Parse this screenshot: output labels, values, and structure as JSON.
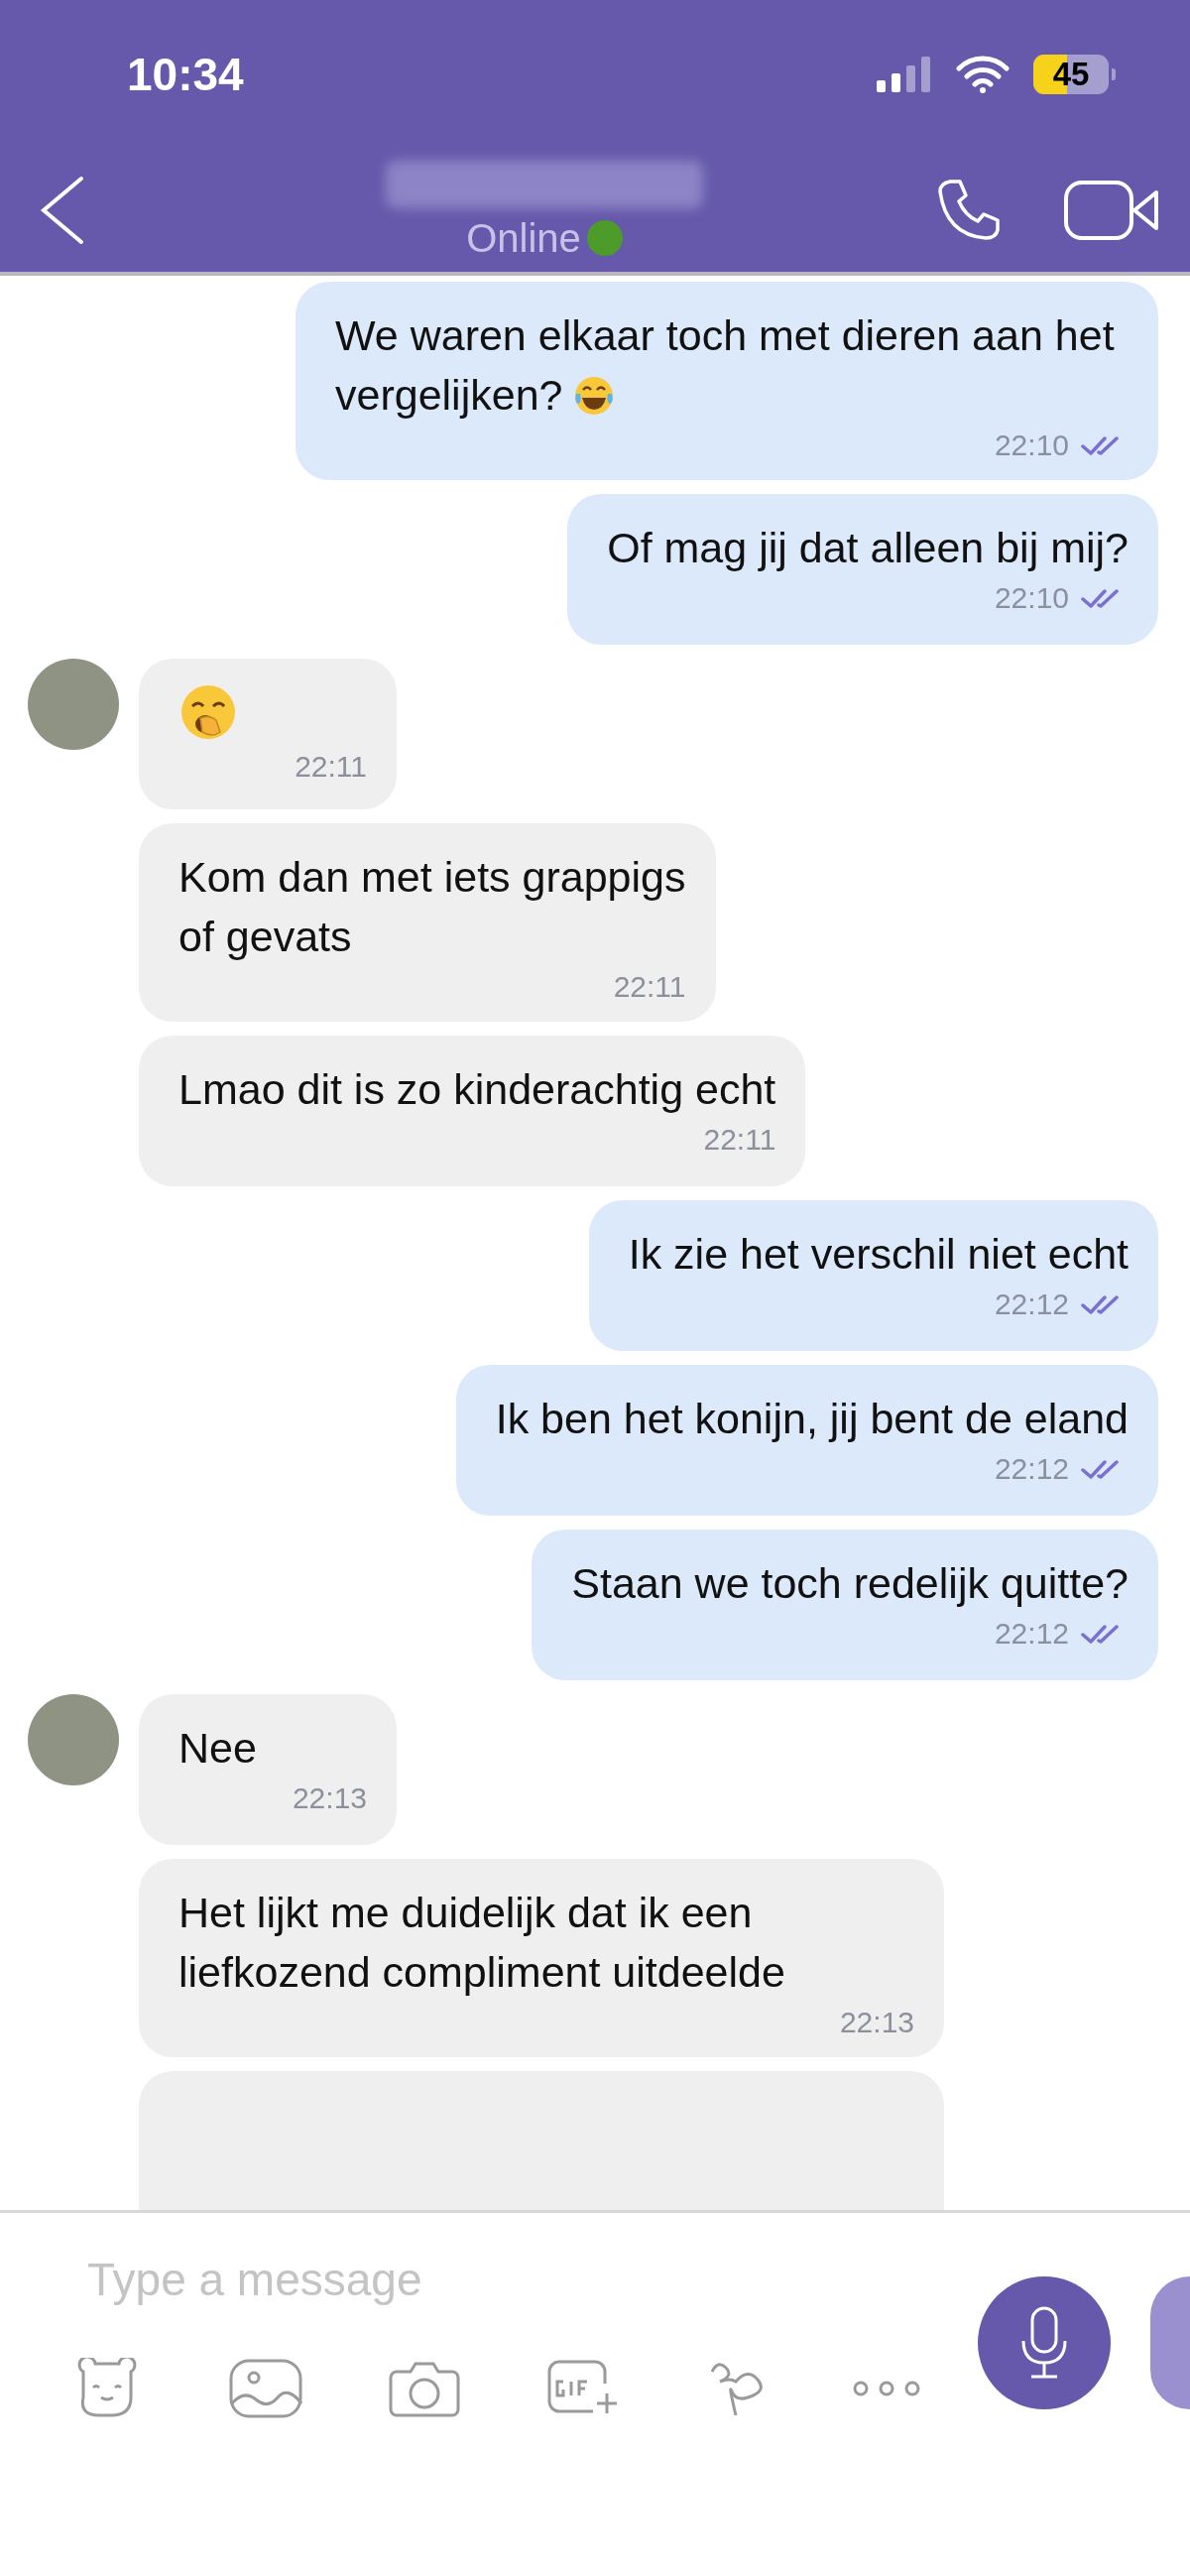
{
  "status_bar": {
    "time": "10:34",
    "battery": "45"
  },
  "header": {
    "status": "Online",
    "online": true
  },
  "messages": [
    {
      "kind": "outgoing_laughing",
      "text": "We waren elkaar toch met dieren aan het vergelijken?",
      "time": "22:10",
      "read": true
    },
    {
      "kind": "outgoing",
      "text": "Of mag jij dat alleen bij mij?",
      "time": "22:10",
      "read": true
    },
    {
      "kind": "incoming_yawning",
      "avatar": true,
      "time": "22:11"
    },
    {
      "kind": "incoming",
      "avatar": false,
      "text": "Kom dan met iets grappigs\nof gevats",
      "time": "22:11"
    },
    {
      "kind": "incoming",
      "avatar": false,
      "text": "Lmao dit is zo kinderachtig echt",
      "time": "22:11"
    },
    {
      "kind": "outgoing",
      "text": "Ik zie het verschil niet echt",
      "time": "22:12",
      "read": true
    },
    {
      "kind": "outgoing",
      "text": "Ik ben het konijn, jij bent de eland",
      "time": "22:12",
      "read": true
    },
    {
      "kind": "outgoing",
      "text": "Staan we toch redelijk quitte?",
      "time": "22:12",
      "read": true
    },
    {
      "kind": "incoming",
      "avatar": true,
      "text": "Nee",
      "time": "22:13"
    },
    {
      "kind": "incoming",
      "avatar": false,
      "text": "Het lijkt me duidelijk dat ik een liefkozend compliment uitdeelde",
      "time": "22:13"
    },
    {
      "kind": "incoming",
      "avatar": false
    }
  ],
  "composer": {
    "placeholder": "Type a message"
  }
}
